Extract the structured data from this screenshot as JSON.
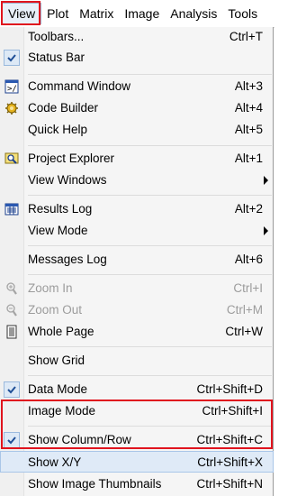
{
  "menubar": {
    "items": [
      {
        "label": "View",
        "active": true
      },
      {
        "label": "Plot"
      },
      {
        "label": "Matrix"
      },
      {
        "label": "Image"
      },
      {
        "label": "Analysis"
      },
      {
        "label": "Tools"
      }
    ]
  },
  "view_menu": {
    "items": [
      {
        "label": "Toolbars...",
        "shortcut": "Ctrl+T"
      },
      {
        "label": "Status Bar",
        "checked": true
      },
      {
        "label": "Command Window",
        "shortcut": "Alt+3",
        "icon": "command-window-icon"
      },
      {
        "label": "Code Builder",
        "shortcut": "Alt+4",
        "icon": "code-builder-icon"
      },
      {
        "label": "Quick Help",
        "shortcut": "Alt+5"
      },
      {
        "label": "Project Explorer",
        "shortcut": "Alt+1",
        "icon": "project-explorer-icon"
      },
      {
        "label": "View Windows",
        "submenu": true
      },
      {
        "label": "Results Log",
        "shortcut": "Alt+2",
        "icon": "results-log-icon"
      },
      {
        "label": "View Mode",
        "submenu": true
      },
      {
        "label": "Messages Log",
        "shortcut": "Alt+6"
      },
      {
        "label": "Zoom In",
        "shortcut": "Ctrl+I",
        "disabled": true,
        "icon": "zoom-in-icon"
      },
      {
        "label": "Zoom Out",
        "shortcut": "Ctrl+M",
        "disabled": true,
        "icon": "zoom-out-icon"
      },
      {
        "label": "Whole Page",
        "shortcut": "Ctrl+W",
        "icon": "whole-page-icon"
      },
      {
        "label": "Show Grid"
      },
      {
        "label": "Data Mode",
        "shortcut": "Ctrl+Shift+D",
        "checked": true
      },
      {
        "label": "Image Mode",
        "shortcut": "Ctrl+Shift+I"
      },
      {
        "label": "Show Column/Row",
        "shortcut": "Ctrl+Shift+C",
        "checked": true
      },
      {
        "label": "Show X/Y",
        "shortcut": "Ctrl+Shift+X",
        "highlighted": true
      },
      {
        "label": "Show Image Thumbnails",
        "shortcut": "Ctrl+Shift+N"
      }
    ]
  },
  "colors": {
    "highlight_border": "#e0141e",
    "hover_bg": "#dfeaf7",
    "check_bg": "#dde9f6"
  }
}
